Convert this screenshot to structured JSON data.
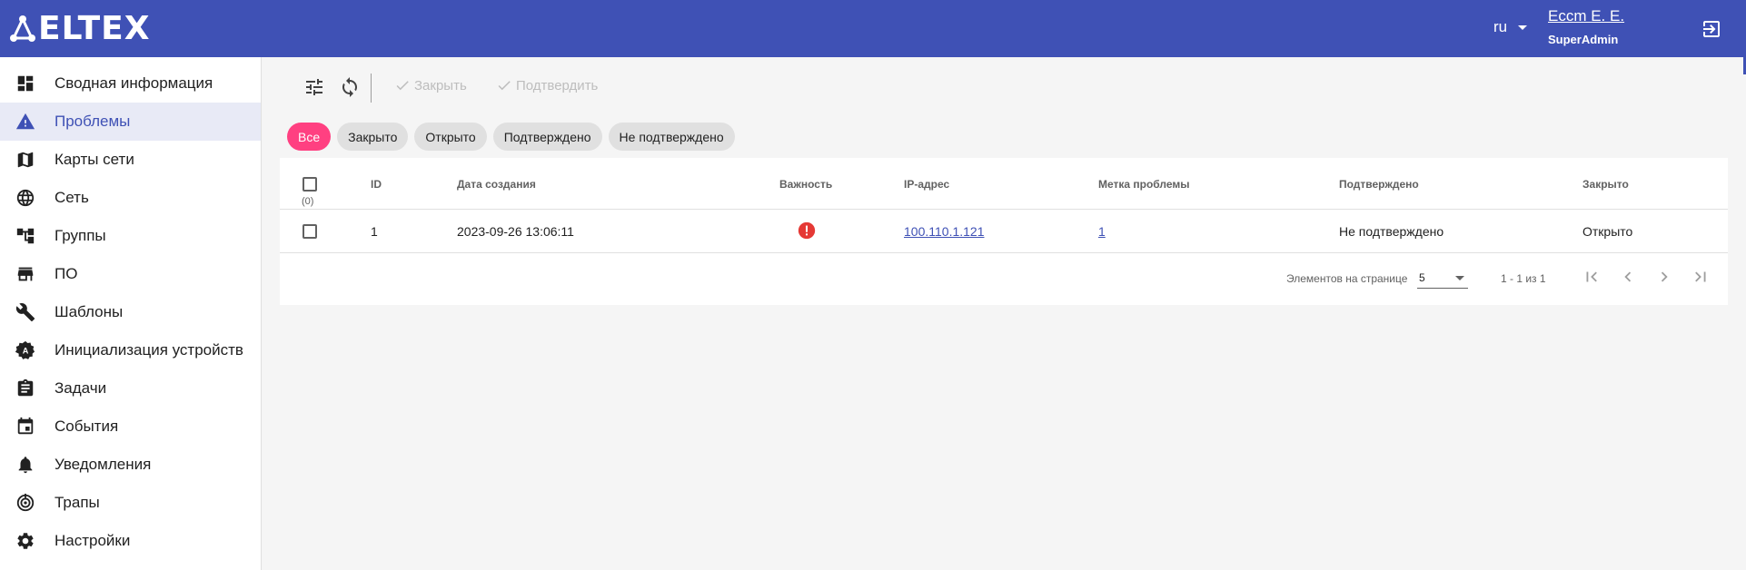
{
  "header": {
    "logo_text": "ELTEX",
    "language": "ru",
    "user_name": "Eccm E. E.",
    "user_role": "SuperAdmin"
  },
  "sidebar": {
    "items": [
      {
        "label": "Сводная информация",
        "icon": "dashboard-icon",
        "active": false
      },
      {
        "label": "Проблемы",
        "icon": "warning-icon",
        "active": true
      },
      {
        "label": "Карты сети",
        "icon": "map-icon",
        "active": false
      },
      {
        "label": "Сеть",
        "icon": "globe-icon",
        "active": false
      },
      {
        "label": "Группы",
        "icon": "hierarchy-icon",
        "active": false
      },
      {
        "label": "ПО",
        "icon": "store-icon",
        "active": false
      },
      {
        "label": "Шаблоны",
        "icon": "wrench-icon",
        "active": false
      },
      {
        "label": "Инициализация устройств",
        "icon": "auto-gear-icon",
        "active": false
      },
      {
        "label": "Задачи",
        "icon": "clipboard-icon",
        "active": false
      },
      {
        "label": "События",
        "icon": "calendar-icon",
        "active": false
      },
      {
        "label": "Уведомления",
        "icon": "bell-icon",
        "active": false
      },
      {
        "label": "Трапы",
        "icon": "trap-icon",
        "active": false
      },
      {
        "label": "Настройки",
        "icon": "gear-icon",
        "active": false
      }
    ]
  },
  "toolbar": {
    "close_label": "Закрыть",
    "confirm_label": "Подтвердить"
  },
  "filters": {
    "chips": [
      "Все",
      "Закрыто",
      "Открыто",
      "Подтверждено",
      "Не подтверждено"
    ],
    "active": "Все"
  },
  "table": {
    "selected_count": "(0)",
    "columns": {
      "id": "ID",
      "created": "Дата создания",
      "severity": "Важность",
      "ip": "IP-адрес",
      "label": "Метка проблемы",
      "confirmed": "Подтверждено",
      "closed": "Закрыто"
    },
    "rows": [
      {
        "id": "1",
        "created": "2023-09-26 13:06:11",
        "severity": "critical",
        "ip": "100.110.1.121",
        "label": "1",
        "confirmed": "Не подтверждено",
        "closed": "Открыто"
      }
    ]
  },
  "pagination": {
    "items_per_page_label": "Элементов на странице",
    "items_per_page": "5",
    "range": "1 - 1 из 1"
  },
  "colors": {
    "primary": "#3f51b5",
    "accent": "#ff4081",
    "danger": "#e53935"
  }
}
